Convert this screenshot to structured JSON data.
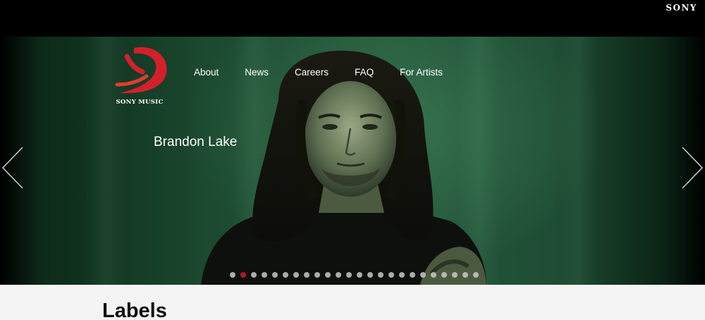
{
  "topbar": {
    "brand": "SONY"
  },
  "logo": {
    "text": "SONY MUSIC",
    "accent_color": "#d4202a"
  },
  "nav": {
    "items": [
      {
        "label": "About"
      },
      {
        "label": "News"
      },
      {
        "label": "Careers"
      },
      {
        "label": "FAQ"
      },
      {
        "label": "For Artists"
      }
    ]
  },
  "hero": {
    "artist_name": "Brandon Lake",
    "slides_total": 24,
    "active_slide": 2,
    "prev_icon": "chevron-left-icon",
    "next_icon": "chevron-right-icon",
    "background_color": "#24553a"
  },
  "labels": {
    "title": "Labels"
  }
}
